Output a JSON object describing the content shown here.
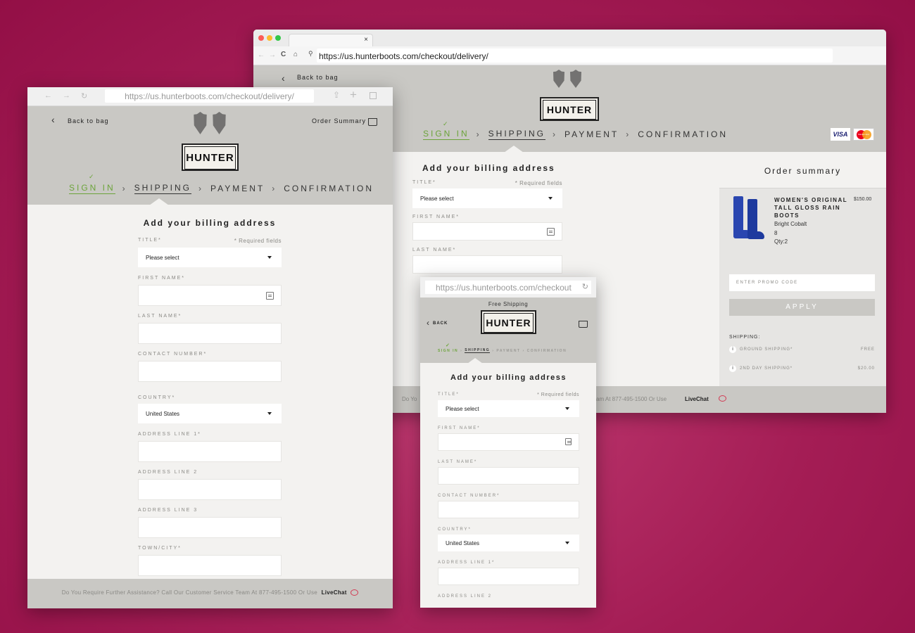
{
  "large": {
    "url": "https://us.hunterboots.com/checkout/delivery/",
    "tab_close": "×",
    "back_label": "Back to bag",
    "logo": "HUNTER",
    "steps": [
      "SIGN IN",
      "SHIPPING",
      "PAYMENT",
      "CONFIRMATION"
    ],
    "billing_title": "Add your billing address",
    "title_label": "TITLE*",
    "required": "* Required fields",
    "title_value": "Please select",
    "first_name_label": "FIRST NAME*",
    "last_name_label": "LAST NAME*",
    "footer_prefix": "Do Yo",
    "footer_suffix": "am At 877-495-1500 Or Use",
    "livechat": "LiveChat",
    "cards": {
      "visa": "VISA",
      "mc": "MasterCard"
    },
    "summary": {
      "title": "Order summary",
      "product_name": "WOMEN'S ORIGINAL TALL GLOSS RAIN BOOTS",
      "price": "$150.00",
      "color": "Bright Cobalt",
      "size": "8",
      "qty": "Qty:2",
      "promo_placeholder": "ENTER PROMO CODE",
      "apply": "APPLY",
      "shipping_label": "SHIPPING:",
      "options": [
        {
          "name": "GROUND SHIPPING*",
          "price": "FREE"
        },
        {
          "name": "2ND DAY SHIPPING*",
          "price": "$20.00"
        }
      ]
    }
  },
  "tablet": {
    "url": "https://us.hunterboots.com/checkout/delivery/",
    "back_label": "Back to bag",
    "order_summary": "Order Summary",
    "logo": "HUNTER",
    "steps": [
      "SIGN IN",
      "SHIPPING",
      "PAYMENT",
      "CONFIRMATION"
    ],
    "billing_title": "Add your billing address",
    "title_label": "TITLE*",
    "required": "* Required fields",
    "title_value": "Please select",
    "first_name_label": "FIRST NAME*",
    "last_name_label": "LAST NAME*",
    "contact_label": "CONTACT NUMBER*",
    "country_label": "COUNTRY*",
    "country_value": "United States",
    "addr1_label": "ADDRESS LINE 1*",
    "addr2_label": "ADDRESS LINE 2",
    "addr3_label": "ADDRESS LINE 3",
    "town_label": "TOWN/CITY*",
    "footer": "Do You Require Further Assistance? Call Our Customer Service Team At 877-495-1500 Or Use",
    "livechat": "LiveChat"
  },
  "mobile": {
    "url": "https://us.hunterboots.com/checkout",
    "free_shipping": "Free Shipping",
    "back_label": "BACK",
    "logo": "HUNTER",
    "steps": [
      "SIGN IN",
      "SHIPPING",
      "PAYMENT",
      "CONFIRMATION"
    ],
    "billing_title": "Add your billing address",
    "title_label": "TITLE*",
    "required": "* Required fields",
    "title_value": "Please select",
    "first_name_label": "FIRST NAME*",
    "last_name_label": "LAST NAME*",
    "contact_label": "CONTACT NUMBER*",
    "country_label": "COUNTRY*",
    "country_value": "United States",
    "addr1_label": "ADDRESS LINE 1*",
    "addr2_label": "ADDRESS LINE 2"
  }
}
